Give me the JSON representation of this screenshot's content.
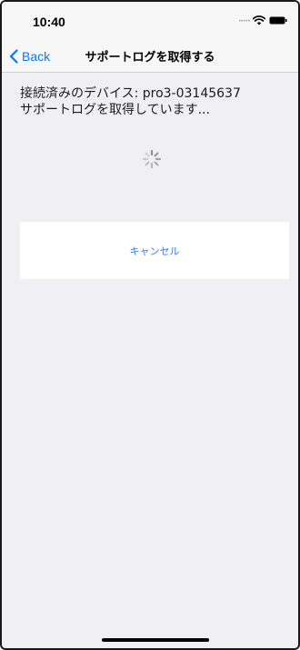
{
  "status_bar": {
    "time": "10:40",
    "icons": [
      "signal-dots-icon",
      "wifi-icon",
      "battery-icon"
    ]
  },
  "nav": {
    "back_label": "Back",
    "title": "サポートログを取得する"
  },
  "content": {
    "connected_device": "接続済みのデバイス: pro3-03145637",
    "progress_message": "サポートログを取得しています..."
  },
  "actions": {
    "cancel_label": "キャンセル"
  },
  "colors": {
    "accent": "#007aff",
    "background": "#efeff4",
    "bar_background": "#f7f7f7"
  }
}
